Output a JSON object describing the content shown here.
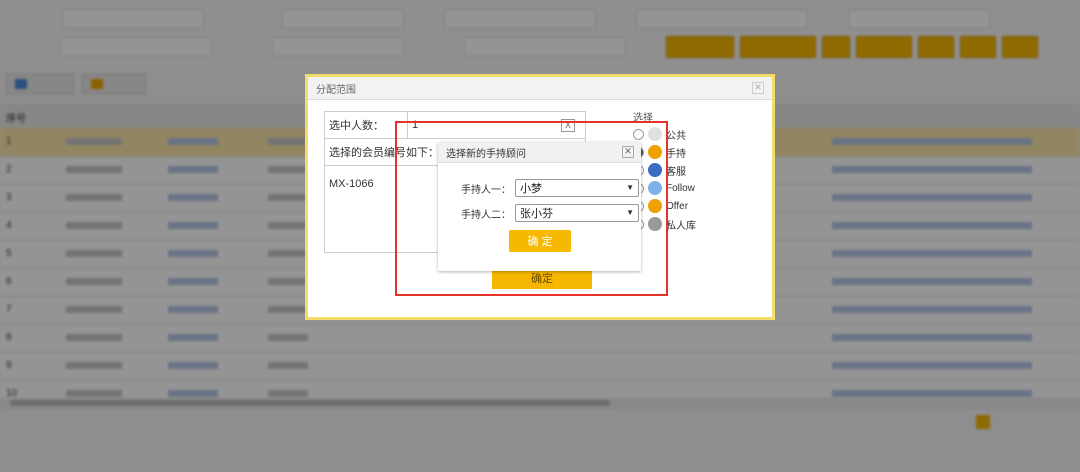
{
  "dialog_assign": {
    "title": "分配范围",
    "selected_count_label": "选中人数：",
    "selected_count_value": "1",
    "clear_symbol": "X",
    "member_list_label": "选择的会员编号如下：",
    "member_code": "MX-1066",
    "confirm_label": "确定",
    "pick_header": "选择",
    "options": [
      "公共",
      "手持",
      "客服",
      "Follow",
      "Offer",
      "私人库"
    ]
  },
  "dialog_select": {
    "title": "选择新的手持顾问",
    "holder1_label": "手持人一：",
    "holder1_value": "小梦",
    "holder2_label": "手持人二：",
    "holder2_value": "张小芬",
    "confirm_label": "确 定"
  },
  "table": {
    "row_numbers": [
      "1",
      "2",
      "3",
      "4",
      "5",
      "6",
      "7",
      "8",
      "9",
      "10"
    ],
    "header_first": "序号"
  },
  "colors": {
    "accent": "#f5b700",
    "highlight_box": "#e5322b",
    "selected_row": "#fbe6a8"
  }
}
